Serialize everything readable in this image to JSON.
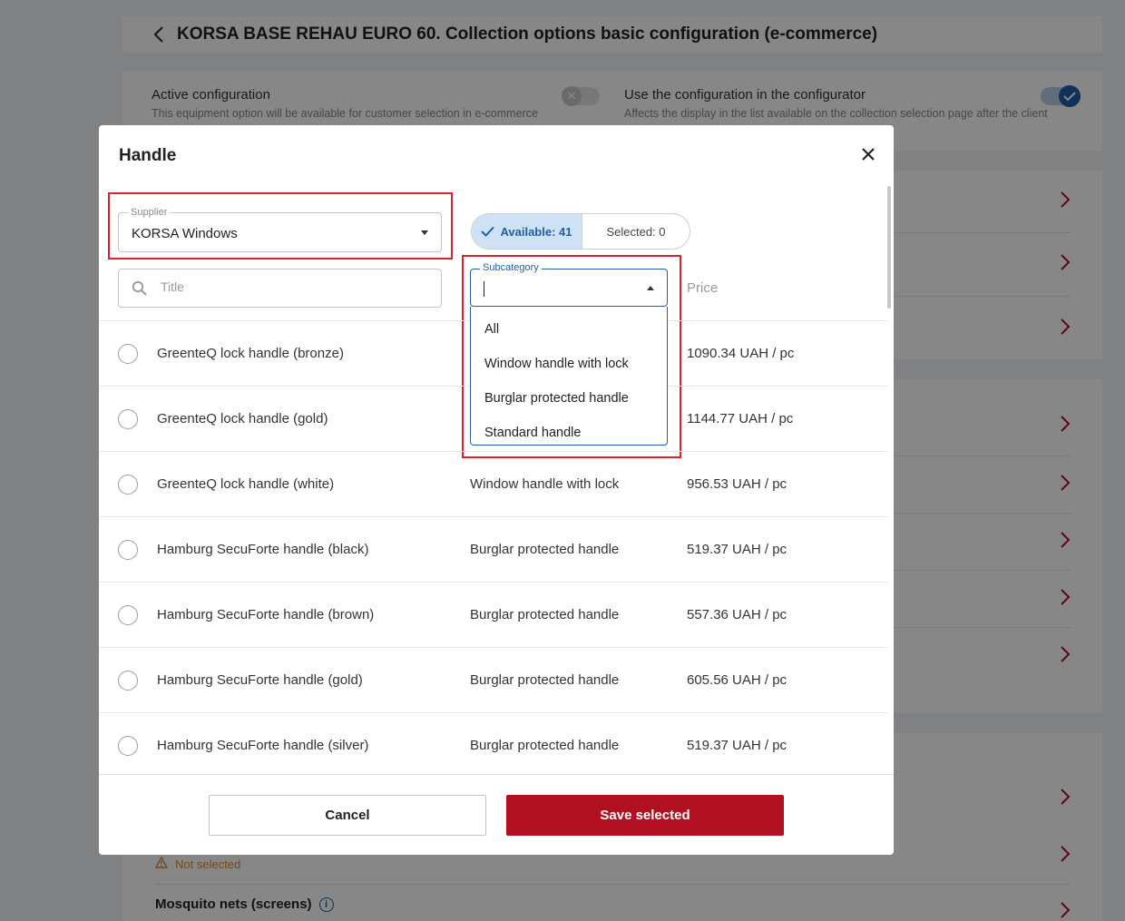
{
  "page": {
    "title": "KORSA BASE REHAU EURO 60. Collection options basic configuration (e-commerce)",
    "active_config": {
      "label": "Active configuration",
      "description": "This equipment option will be available for customer selection in e-commerce"
    },
    "use_config": {
      "label": "Use the configuration in the configurator",
      "description": "Affects the display in the list available on the collection selection page after the client"
    },
    "not_selected_label": "Not selected",
    "mosquito_nets_label": "Mosquito nets (screens)"
  },
  "modal": {
    "title": "Handle",
    "supplier": {
      "legend": "Supplier",
      "value": "KORSA Windows"
    },
    "search": {
      "placeholder": "Title"
    },
    "tabs": {
      "available": "Available: 41",
      "selected": "Selected: 0"
    },
    "subcategory": {
      "legend": "Subcategory",
      "options": [
        "All",
        "Window handle with lock",
        "Burglar protected handle",
        "Standard handle"
      ]
    },
    "columns": {
      "price": "Price"
    },
    "rows": [
      {
        "name": "GreenteQ lock handle (bronze)",
        "category": "",
        "price": "1090.34 UAH / pc"
      },
      {
        "name": "GreenteQ lock handle (gold)",
        "category": "",
        "price": "1144.77 UAH / pc"
      },
      {
        "name": "GreenteQ lock handle (white)",
        "category": "Window handle with lock",
        "price": "956.53 UAH / pc"
      },
      {
        "name": "Hamburg SecuForte handle (black)",
        "category": "Burglar protected handle",
        "price": "519.37 UAH / pc"
      },
      {
        "name": "Hamburg SecuForte handle (brown)",
        "category": "Burglar protected handle",
        "price": "557.36 UAH / pc"
      },
      {
        "name": "Hamburg SecuForte handle (gold)",
        "category": "Burglar protected handle",
        "price": "605.56 UAH / pc"
      },
      {
        "name": "Hamburg SecuForte handle (silver)",
        "category": "Burglar protected handle",
        "price": "519.37 UAH / pc"
      }
    ],
    "buttons": {
      "cancel": "Cancel",
      "save": "Save selected"
    }
  },
  "colors": {
    "accent_blue": "#1f5ea8",
    "primary_red": "#b01020",
    "highlight_red": "#d8232f",
    "warning_orange": "#e0892b"
  }
}
